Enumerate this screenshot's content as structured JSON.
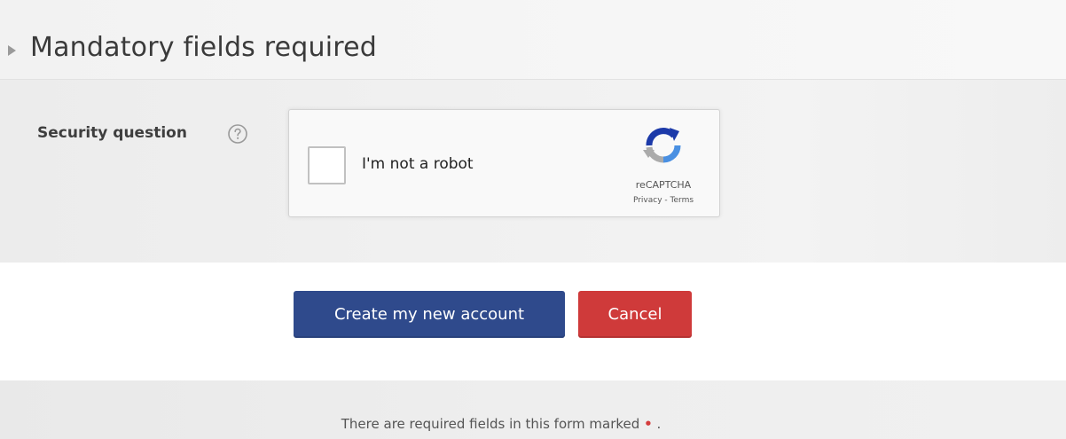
{
  "section": {
    "legend_title": "Mandatory fields required"
  },
  "security_question": {
    "label": "Security question",
    "help_icon": "question-circle-icon"
  },
  "recaptcha": {
    "checkbox_label": "I'm not a robot",
    "brand": "reCAPTCHA",
    "privacy_link": "Privacy",
    "separator": " - ",
    "terms_link": "Terms",
    "checked": false
  },
  "buttons": {
    "submit_label": "Create my new account",
    "cancel_label": "Cancel"
  },
  "footer": {
    "required_note": "There are required fields in this form marked",
    "required_marker": "•",
    "required_note_end": " ."
  },
  "colors": {
    "primary_button": "#2f4a8c",
    "cancel_button": "#cf3a3a",
    "required_marker": "#d43c3c"
  }
}
